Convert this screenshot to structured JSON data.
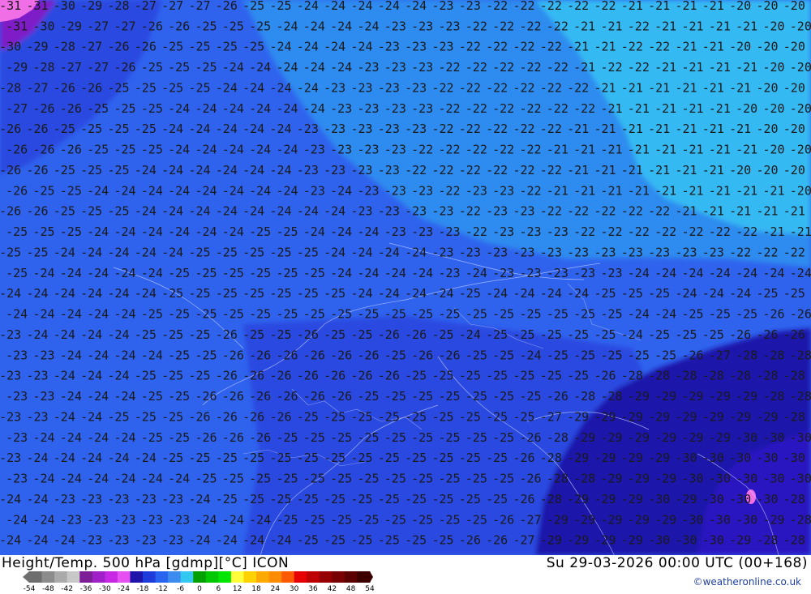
{
  "title_left": "Height/Temp. 500 hPa [gdmp][°C] ICON",
  "title_right": "Su 29-03-2026 00:00 UTC (00+168)",
  "credit": "©weatheronline.co.uk",
  "legend": {
    "ticks": [
      "-54",
      "-48",
      "-42",
      "-36",
      "-30",
      "-24",
      "-18",
      "-12",
      "-6",
      "0",
      "6",
      "12",
      "18",
      "24",
      "30",
      "36",
      "42",
      "48",
      "54"
    ],
    "colors": [
      "#6e6e6e",
      "#8c8c8c",
      "#aaaaaa",
      "#c8c8c8",
      "#7e1e96",
      "#a020c8",
      "#c828e6",
      "#e650f0",
      "#1e14aa",
      "#1e3cdc",
      "#2864f0",
      "#3c8cf0",
      "#32c8f0",
      "#00a000",
      "#00c800",
      "#00e600",
      "#ffff3c",
      "#ffd200",
      "#ffaa00",
      "#ff8c00",
      "#ff5a00",
      "#e60000",
      "#be0000",
      "#960000",
      "#780000",
      "#5a0000",
      "#3c0000"
    ]
  },
  "map_colors": {
    "minus_20": "#35b9f3",
    "minus_22": "#2d8bef",
    "minus_24": "#2f63ee",
    "minus_26": "#2b4ae0",
    "minus_28": "#1e14aa",
    "minus_30": "#2a14c0",
    "minus_34": "#b428d2",
    "plus_minus_8": "#f06ee6",
    "contour_label": "#1a1a1a"
  },
  "isotherm_rows": [
    [
      "31",
      "31",
      "30",
      "29",
      "28",
      "27",
      "27",
      "27",
      "26",
      "25",
      "25",
      "24",
      "24",
      "24",
      "24",
      "24",
      "23",
      "23",
      "22",
      "22",
      "22",
      "22",
      "22",
      "21",
      "21",
      "21",
      "21",
      "20",
      "20",
      "20"
    ],
    [
      "31",
      "30",
      "29",
      "27",
      "27",
      "26",
      "26",
      "25",
      "25",
      "25",
      "24",
      "24",
      "24",
      "24",
      "23",
      "23",
      "23",
      "22",
      "22",
      "22",
      "22",
      "21",
      "21",
      "22",
      "21",
      "21",
      "21",
      "21",
      "20",
      "20"
    ],
    [
      "30",
      "29",
      "28",
      "27",
      "26",
      "26",
      "25",
      "25",
      "25",
      "25",
      "24",
      "24",
      "24",
      "24",
      "23",
      "23",
      "23",
      "22",
      "22",
      "22",
      "22",
      "21",
      "21",
      "22",
      "22",
      "21",
      "21",
      "20",
      "20",
      "20"
    ],
    [
      "29",
      "28",
      "27",
      "27",
      "26",
      "25",
      "25",
      "25",
      "24",
      "24",
      "24",
      "24",
      "24",
      "23",
      "23",
      "23",
      "22",
      "22",
      "22",
      "22",
      "22",
      "21",
      "22",
      "22",
      "21",
      "21",
      "21",
      "21",
      "20",
      "20"
    ],
    [
      "28",
      "27",
      "26",
      "26",
      "25",
      "25",
      "25",
      "25",
      "24",
      "24",
      "24",
      "24",
      "23",
      "23",
      "23",
      "23",
      "22",
      "22",
      "22",
      "22",
      "22",
      "22",
      "21",
      "21",
      "21",
      "21",
      "21",
      "21",
      "20",
      "20"
    ],
    [
      "27",
      "26",
      "26",
      "25",
      "25",
      "25",
      "24",
      "24",
      "24",
      "24",
      "24",
      "24",
      "23",
      "23",
      "23",
      "23",
      "22",
      "22",
      "22",
      "22",
      "22",
      "22",
      "21",
      "21",
      "21",
      "21",
      "21",
      "20",
      "20",
      "20"
    ],
    [
      "26",
      "26",
      "25",
      "25",
      "25",
      "25",
      "24",
      "24",
      "24",
      "24",
      "24",
      "23",
      "23",
      "23",
      "23",
      "23",
      "22",
      "22",
      "22",
      "22",
      "22",
      "21",
      "21",
      "21",
      "21",
      "21",
      "21",
      "21",
      "20",
      "20"
    ],
    [
      "26",
      "26",
      "26",
      "25",
      "25",
      "25",
      "24",
      "24",
      "24",
      "24",
      "24",
      "23",
      "23",
      "23",
      "23",
      "22",
      "22",
      "22",
      "22",
      "22",
      "21",
      "21",
      "21",
      "21",
      "21",
      "21",
      "21",
      "21",
      "20",
      "20"
    ],
    [
      "26",
      "26",
      "25",
      "25",
      "25",
      "24",
      "24",
      "24",
      "24",
      "24",
      "24",
      "23",
      "23",
      "23",
      "23",
      "22",
      "22",
      "22",
      "22",
      "22",
      "22",
      "21",
      "21",
      "21",
      "21",
      "21",
      "21",
      "20",
      "20",
      "20"
    ],
    [
      "26",
      "25",
      "25",
      "24",
      "24",
      "24",
      "24",
      "24",
      "24",
      "24",
      "24",
      "23",
      "24",
      "23",
      "23",
      "23",
      "22",
      "23",
      "23",
      "22",
      "21",
      "21",
      "21",
      "21",
      "21",
      "21",
      "21",
      "21",
      "21",
      "20"
    ],
    [
      "26",
      "26",
      "25",
      "25",
      "25",
      "24",
      "24",
      "24",
      "24",
      "24",
      "24",
      "24",
      "24",
      "23",
      "23",
      "23",
      "23",
      "22",
      "23",
      "23",
      "22",
      "22",
      "22",
      "22",
      "22",
      "21",
      "21",
      "21",
      "21",
      "21"
    ],
    [
      "25",
      "25",
      "25",
      "24",
      "24",
      "24",
      "24",
      "24",
      "24",
      "25",
      "25",
      "24",
      "24",
      "24",
      "23",
      "23",
      "23",
      "22",
      "23",
      "23",
      "23",
      "22",
      "22",
      "22",
      "22",
      "22",
      "22",
      "22",
      "21",
      "21"
    ],
    [
      "25",
      "25",
      "24",
      "24",
      "24",
      "24",
      "24",
      "25",
      "25",
      "25",
      "25",
      "25",
      "24",
      "24",
      "24",
      "24",
      "23",
      "23",
      "23",
      "23",
      "23",
      "23",
      "23",
      "23",
      "23",
      "23",
      "23",
      "22",
      "22",
      "22"
    ],
    [
      "25",
      "24",
      "24",
      "24",
      "24",
      "24",
      "25",
      "25",
      "25",
      "25",
      "25",
      "25",
      "24",
      "24",
      "24",
      "24",
      "23",
      "24",
      "23",
      "23",
      "23",
      "23",
      "23",
      "24",
      "24",
      "24",
      "24",
      "24",
      "24",
      "24"
    ],
    [
      "24",
      "24",
      "24",
      "24",
      "24",
      "24",
      "25",
      "25",
      "25",
      "25",
      "25",
      "25",
      "25",
      "24",
      "24",
      "24",
      "24",
      "25",
      "24",
      "24",
      "24",
      "24",
      "25",
      "25",
      "25",
      "24",
      "24",
      "24",
      "25",
      "25"
    ],
    [
      "24",
      "24",
      "24",
      "24",
      "24",
      "25",
      "25",
      "25",
      "25",
      "25",
      "25",
      "25",
      "25",
      "25",
      "25",
      "25",
      "25",
      "25",
      "25",
      "25",
      "25",
      "25",
      "25",
      "24",
      "24",
      "25",
      "25",
      "25",
      "26",
      "26"
    ],
    [
      "23",
      "24",
      "24",
      "24",
      "24",
      "25",
      "25",
      "25",
      "26",
      "25",
      "25",
      "26",
      "25",
      "25",
      "26",
      "26",
      "25",
      "24",
      "25",
      "25",
      "25",
      "25",
      "25",
      "24",
      "25",
      "25",
      "25",
      "26",
      "26",
      "26"
    ],
    [
      "23",
      "23",
      "24",
      "24",
      "24",
      "24",
      "25",
      "25",
      "26",
      "26",
      "26",
      "26",
      "26",
      "26",
      "25",
      "26",
      "26",
      "25",
      "25",
      "24",
      "25",
      "25",
      "25",
      "25",
      "25",
      "26",
      "27",
      "28",
      "28",
      "28"
    ],
    [
      "23",
      "23",
      "24",
      "24",
      "24",
      "25",
      "25",
      "25",
      "26",
      "26",
      "26",
      "26",
      "26",
      "26",
      "26",
      "25",
      "25",
      "25",
      "25",
      "25",
      "25",
      "25",
      "26",
      "28",
      "28",
      "28",
      "28",
      "28",
      "28",
      "28"
    ],
    [
      "23",
      "23",
      "24",
      "24",
      "24",
      "25",
      "25",
      "26",
      "26",
      "26",
      "26",
      "26",
      "26",
      "25",
      "25",
      "25",
      "25",
      "25",
      "25",
      "25",
      "26",
      "28",
      "28",
      "29",
      "29",
      "29",
      "29",
      "29",
      "28",
      "28"
    ],
    [
      "23",
      "23",
      "24",
      "24",
      "25",
      "25",
      "25",
      "26",
      "26",
      "26",
      "26",
      "25",
      "25",
      "25",
      "25",
      "25",
      "25",
      "25",
      "25",
      "25",
      "27",
      "29",
      "29",
      "29",
      "29",
      "29",
      "29",
      "29",
      "29",
      "28"
    ],
    [
      "23",
      "24",
      "24",
      "24",
      "24",
      "25",
      "25",
      "26",
      "26",
      "26",
      "25",
      "25",
      "25",
      "25",
      "25",
      "25",
      "25",
      "25",
      "25",
      "26",
      "28",
      "29",
      "29",
      "29",
      "29",
      "29",
      "29",
      "30",
      "30",
      "30"
    ],
    [
      "23",
      "24",
      "24",
      "24",
      "24",
      "24",
      "25",
      "25",
      "25",
      "25",
      "25",
      "25",
      "25",
      "25",
      "25",
      "25",
      "25",
      "25",
      "25",
      "26",
      "28",
      "29",
      "29",
      "29",
      "29",
      "30",
      "30",
      "30",
      "30",
      "30"
    ],
    [
      "23",
      "24",
      "24",
      "24",
      "24",
      "24",
      "24",
      "25",
      "25",
      "25",
      "25",
      "25",
      "25",
      "25",
      "25",
      "25",
      "25",
      "25",
      "25",
      "26",
      "28",
      "28",
      "29",
      "29",
      "29",
      "30",
      "30",
      "30",
      "30",
      "30"
    ],
    [
      "24",
      "24",
      "23",
      "23",
      "23",
      "23",
      "23",
      "24",
      "25",
      "25",
      "25",
      "25",
      "25",
      "25",
      "25",
      "25",
      "25",
      "25",
      "25",
      "26",
      "28",
      "29",
      "29",
      "29",
      "30",
      "29",
      "30",
      "30",
      "30",
      "28"
    ],
    [
      "24",
      "24",
      "23",
      "23",
      "23",
      "23",
      "23",
      "24",
      "24",
      "24",
      "25",
      "25",
      "25",
      "25",
      "25",
      "25",
      "25",
      "25",
      "26",
      "27",
      "29",
      "29",
      "29",
      "29",
      "29",
      "30",
      "30",
      "30",
      "29",
      "28"
    ],
    [
      "24",
      "24",
      "24",
      "23",
      "23",
      "23",
      "23",
      "24",
      "24",
      "24",
      "24",
      "25",
      "25",
      "25",
      "25",
      "25",
      "25",
      "26",
      "26",
      "27",
      "29",
      "29",
      "29",
      "29",
      "30",
      "30",
      "30",
      "29",
      "28",
      "28"
    ]
  ]
}
